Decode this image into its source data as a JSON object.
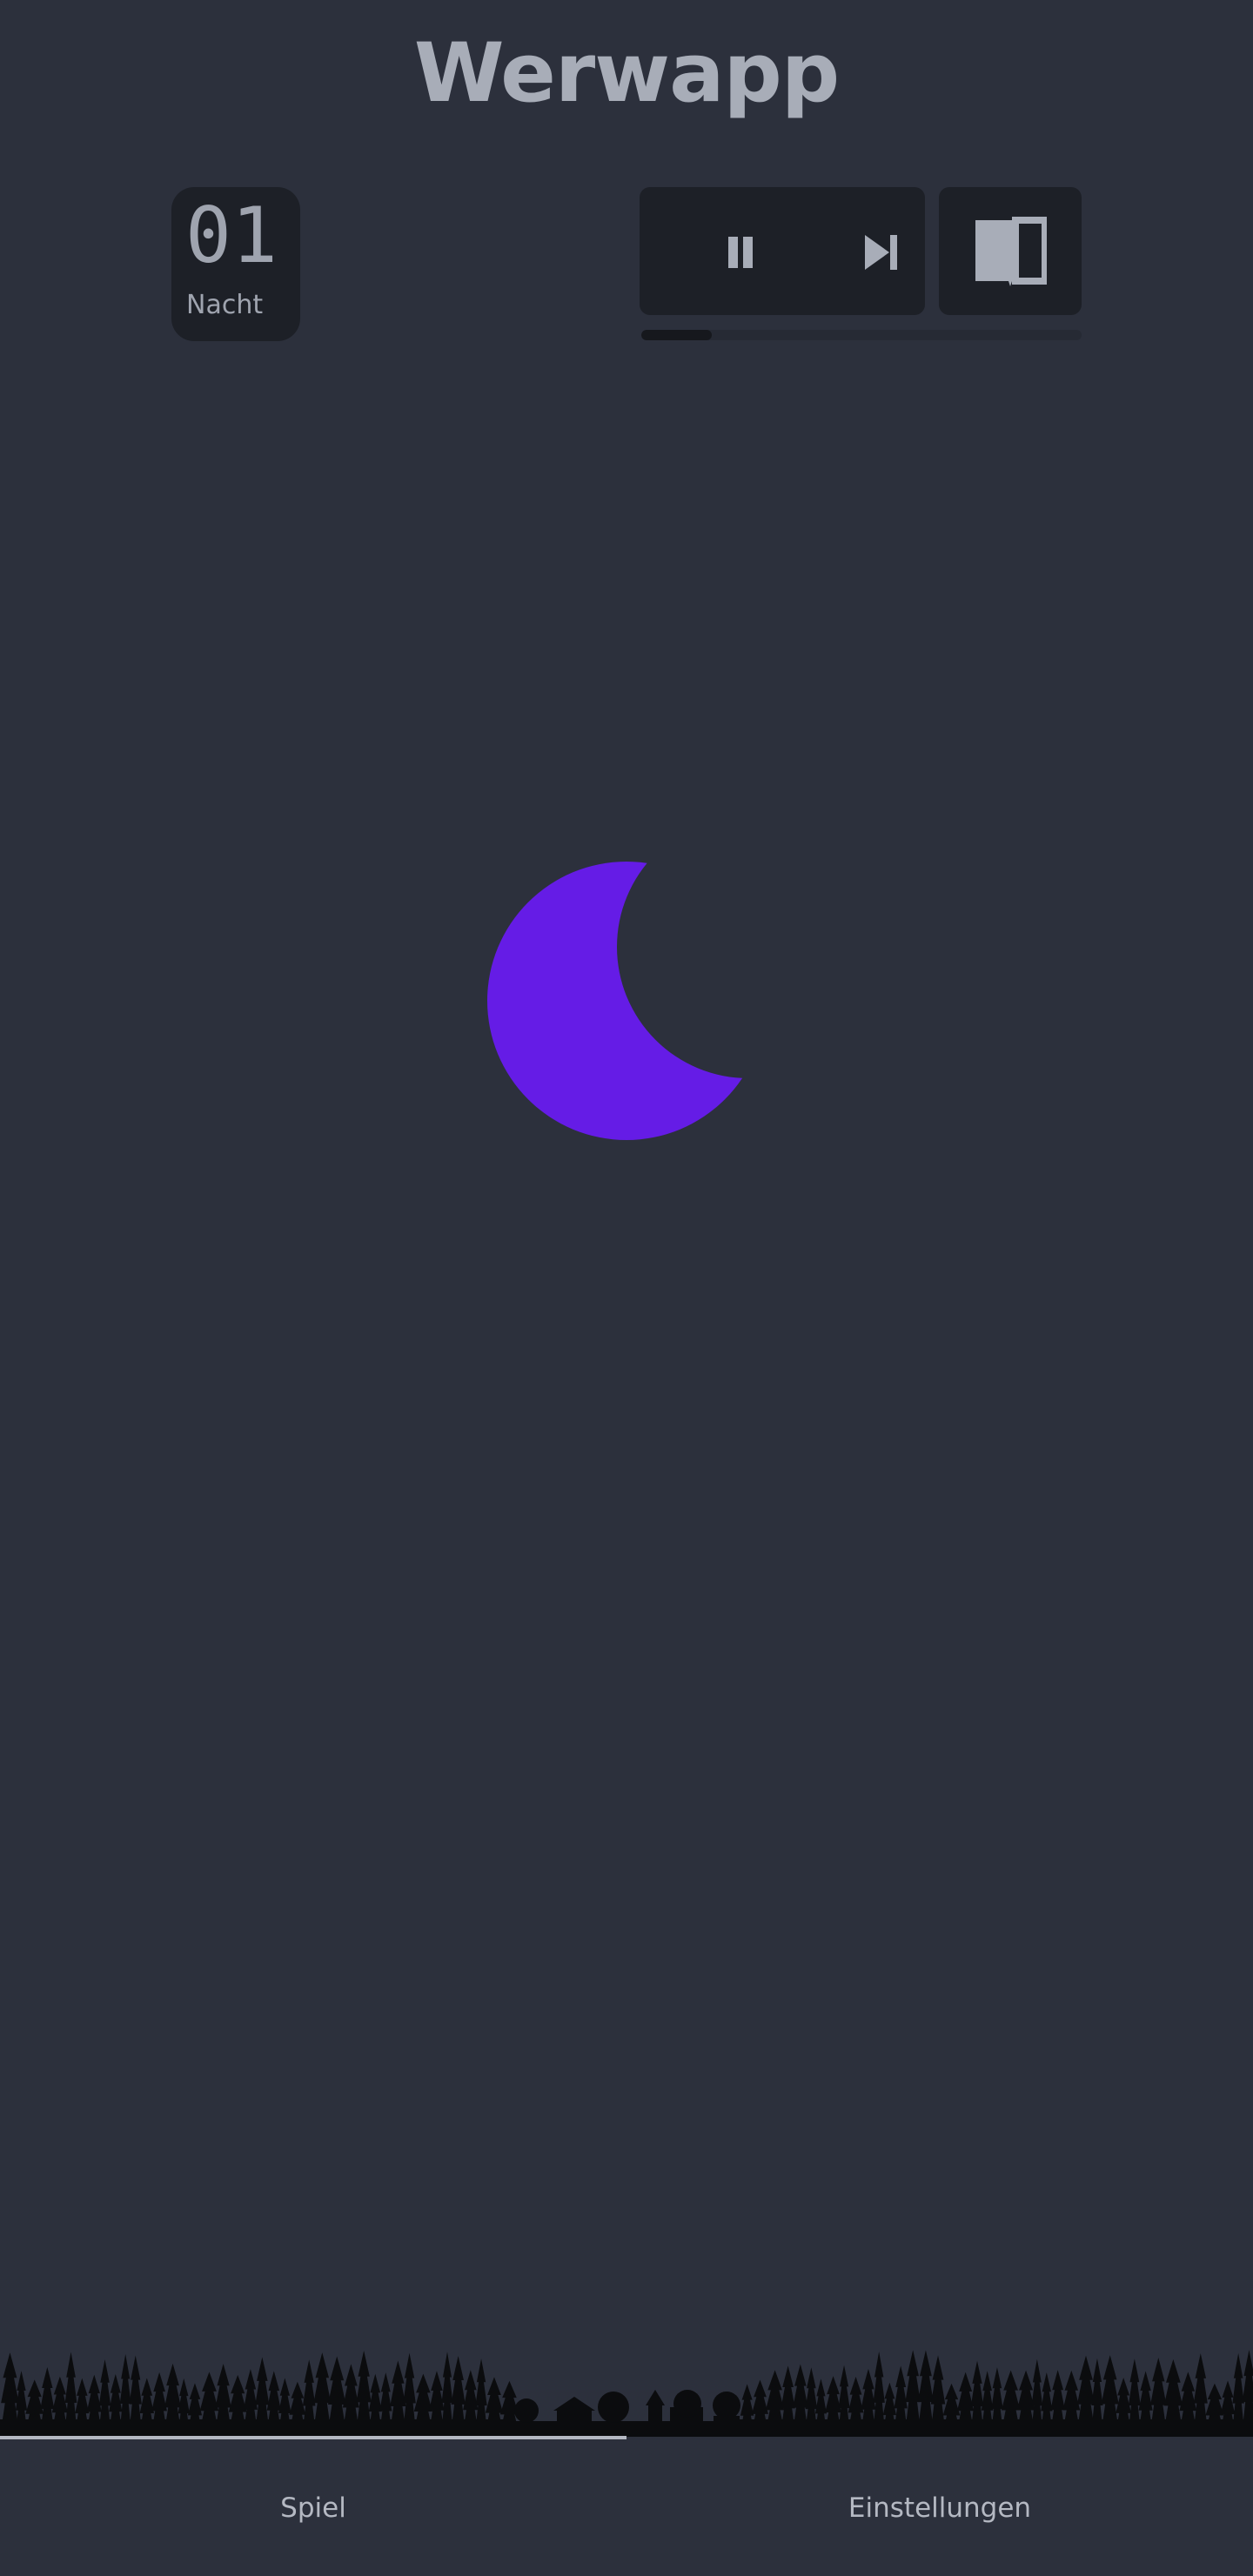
{
  "app": {
    "title": "Werwapp"
  },
  "round": {
    "number": "01",
    "phase": "Nacht"
  },
  "controls": {
    "pause_icon": "pause-icon",
    "skip_icon": "skip-next-icon",
    "rules_icon": "book-icon"
  },
  "timer": {
    "progress_percent": 16
  },
  "scene": {
    "phase_icon": "moon-icon",
    "moon_color": "#651ce6"
  },
  "tabs": [
    {
      "label": "Spiel",
      "active": true
    },
    {
      "label": "Einstellungen",
      "active": false
    }
  ],
  "colors": {
    "background": "#2c303c",
    "panel": "#1d2027",
    "text": "#a8adb8",
    "accent": "#651ce6"
  }
}
